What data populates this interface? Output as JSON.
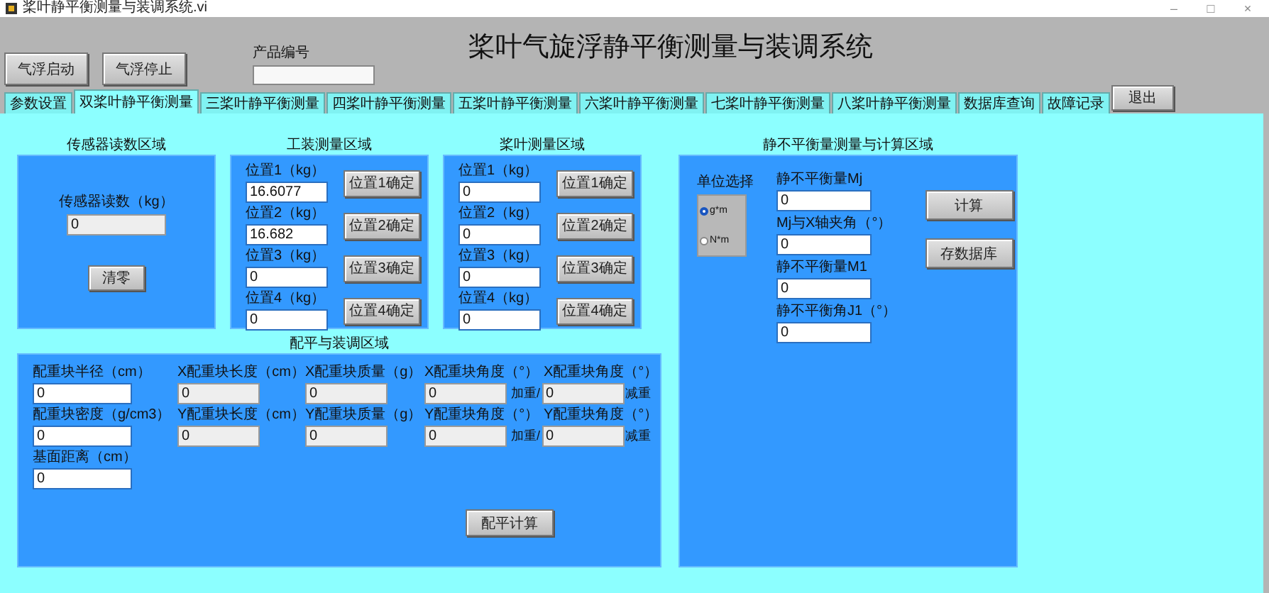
{
  "window": {
    "title": "桨叶静平衡测量与装调系统.vi",
    "controls": [
      "–",
      "□",
      "×"
    ]
  },
  "header": {
    "buttons": [
      "气浮启动",
      "气浮停止"
    ],
    "product_label": "产品编号",
    "title": "桨叶气旋浮静平衡测量与装调系统",
    "exit_button": "退出"
  },
  "tabs": [
    {
      "label": "参数设置",
      "selected": false
    },
    {
      "label": "双桨叶静平衡测量",
      "selected": true
    },
    {
      "label": "三桨叶静平衡测量",
      "selected": false
    },
    {
      "label": "四桨叶静平衡测量",
      "selected": false
    },
    {
      "label": "五桨叶静平衡测量",
      "selected": false
    },
    {
      "label": "六桨叶静平衡测量",
      "selected": false
    },
    {
      "label": "七桨叶静平衡测量",
      "selected": false
    },
    {
      "label": "八桨叶静平衡测量",
      "selected": false
    },
    {
      "label": "数据库查询",
      "selected": false
    },
    {
      "label": "故障记录",
      "selected": false
    }
  ],
  "sensor_panel": {
    "caption": "传感器读数区域",
    "field": {
      "label": "传感器读数（kg）",
      "value": "0",
      "kind": "indicator"
    },
    "button": "清零"
  },
  "tooling_panel": {
    "caption": "工装测量区域",
    "rows": [
      {
        "label": "位置1（kg）",
        "value": "16.6077",
        "button": "位置1确定"
      },
      {
        "label": "位置2（kg）",
        "value": "16.682",
        "button": "位置2确定"
      },
      {
        "label": "位置3（kg）",
        "value": "0",
        "button": "位置3确定"
      },
      {
        "label": "位置4（kg）",
        "value": "0",
        "button": "位置4确定"
      }
    ]
  },
  "blade_panel": {
    "caption": "桨叶测量区域",
    "rows": [
      {
        "label": "位置1（kg）",
        "value": "0",
        "button": "位置1确定"
      },
      {
        "label": "位置2（kg）",
        "value": "0",
        "button": "位置2确定"
      },
      {
        "label": "位置3（kg）",
        "value": "0",
        "button": "位置3确定"
      },
      {
        "label": "位置4（kg）",
        "value": "0",
        "button": "位置4确定"
      }
    ]
  },
  "static_panel": {
    "caption": "静不平衡量测量与计算区域",
    "unit_select": {
      "label": "单位选择",
      "options": [
        {
          "label": "g*m",
          "selected": true
        },
        {
          "label": "N*m",
          "selected": false
        }
      ]
    },
    "fields": [
      {
        "label": "静不平衡量Mj",
        "value": "0"
      },
      {
        "label": "Mj与X轴夹角（°）",
        "value": "0"
      },
      {
        "label": "静不平衡量M1",
        "value": "0"
      },
      {
        "label": "静不平衡角J1（°）",
        "value": "0"
      }
    ],
    "buttons": [
      "计算",
      "存数据库"
    ]
  },
  "balance_panel": {
    "caption": "配平与装调区域",
    "rows": [
      {
        "cells": [
          {
            "label": "配重块半径（cm）",
            "value": "0",
            "kind": "input"
          },
          {
            "label": "X配重块长度（cm）",
            "value": "0",
            "kind": "indicator"
          },
          {
            "label": "X配重块质量（g）",
            "value": "0",
            "kind": "indicator"
          },
          {
            "label": "X配重块角度（°）",
            "value": "0",
            "kind": "indicator"
          },
          {
            "label": "X配重块角度（°）",
            "value": "0",
            "kind": "indicator",
            "prefix": "加重/",
            "suffix": "减重"
          }
        ]
      },
      {
        "cells": [
          {
            "label": "配重块密度（g/cm3）",
            "value": "0",
            "kind": "input"
          },
          {
            "label": "Y配重块长度（cm）",
            "value": "0",
            "kind": "indicator"
          },
          {
            "label": "Y配重块质量（g）",
            "value": "0",
            "kind": "indicator"
          },
          {
            "label": "Y配重块角度（°）",
            "value": "0",
            "kind": "indicator"
          },
          {
            "label": "Y配重块角度（°）",
            "value": "0",
            "kind": "indicator",
            "prefix": "加重/",
            "suffix": "减重"
          }
        ]
      },
      {
        "cells": [
          {
            "label": "基面距离（cm）",
            "value": "0",
            "kind": "input"
          }
        ]
      }
    ],
    "button": "配平计算"
  }
}
